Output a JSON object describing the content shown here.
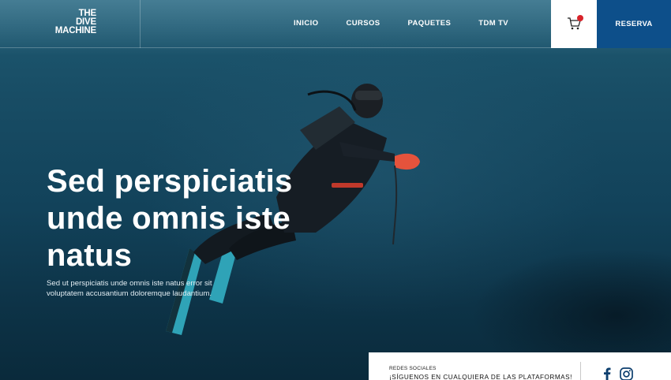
{
  "header": {
    "logo_lines": [
      "THE",
      "DIVE",
      "MACHINE"
    ],
    "nav": [
      "INICIO",
      "CURSOS",
      "PAQUETES",
      "TDM TV"
    ],
    "cart_icon": "cart-icon",
    "reserve_label": "RESERVA"
  },
  "hero": {
    "title": "Sed perspiciatis unde omnis iste natus",
    "subtitle": "Sed ut perspiciatis unde omnis iste natus error sit voluptatem accusantium doloremque laudantium."
  },
  "social": {
    "label": "REDES SOCIALES",
    "headline": "¡SÍGUENOS EN CUALQUIERA DE LAS PLATAFORMAS!",
    "icons": [
      "facebook-icon",
      "instagram-icon"
    ]
  },
  "colors": {
    "accent_blue": "#0d4f8a",
    "cart_badge": "#d8232a",
    "water_dark": "#0a2a3b"
  }
}
